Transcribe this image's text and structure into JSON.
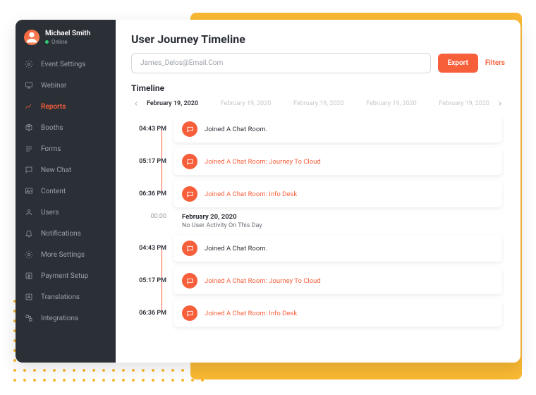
{
  "profile": {
    "name": "Michael Smith",
    "status": "Online"
  },
  "sidebar": {
    "items": [
      {
        "label": "Event Settings",
        "icon": "gear"
      },
      {
        "label": "Webinar",
        "icon": "monitor"
      },
      {
        "label": "Reports",
        "icon": "chart",
        "active": true
      },
      {
        "label": "Booths",
        "icon": "cube"
      },
      {
        "label": "Forms",
        "icon": "form"
      },
      {
        "label": "New Chat",
        "icon": "chat"
      },
      {
        "label": "Content",
        "icon": "image"
      },
      {
        "label": "Users",
        "icon": "user"
      },
      {
        "label": "Notifications",
        "icon": "bell"
      },
      {
        "label": "More Settings",
        "icon": "gear"
      },
      {
        "label": "Payment Setup",
        "icon": "dollar"
      },
      {
        "label": "Translations",
        "icon": "lang"
      },
      {
        "label": "Integrations",
        "icon": "integration"
      }
    ]
  },
  "header": {
    "title": "User Journey Timeline",
    "search_value": "James_Delos@Email.Com",
    "export_label": "Export",
    "filters_label": "Filters",
    "section_label": "Timeline"
  },
  "dates": [
    "February 19, 2020",
    "February 19, 2020",
    "February 19, 2020",
    "February 19, 2020",
    "February 19, 2020"
  ],
  "active_date_index": 0,
  "timeline": [
    {
      "time": "04:43 PM",
      "text": "Joined A Chat Room.",
      "highlight": false
    },
    {
      "time": "05:17 PM",
      "text": "Joined A Chat Room: Journey To Cloud",
      "highlight": true
    },
    {
      "time": "06:36 PM",
      "text": "Joined A Chat Room: Info Desk",
      "highlight": true,
      "last": true
    }
  ],
  "day_break": {
    "time": "00:00",
    "date": "February 20, 2020",
    "msg": "No User Activity On This Day"
  },
  "timeline2": [
    {
      "time": "04:43 PM",
      "text": "Joined A Chat Room.",
      "highlight": false
    },
    {
      "time": "05:17 PM",
      "text": "Joined A Chat Room: Journey To Cloud",
      "highlight": true
    },
    {
      "time": "06:36 PM",
      "text": "Joined A Chat Room: Info Desk",
      "highlight": true,
      "last": true
    }
  ]
}
